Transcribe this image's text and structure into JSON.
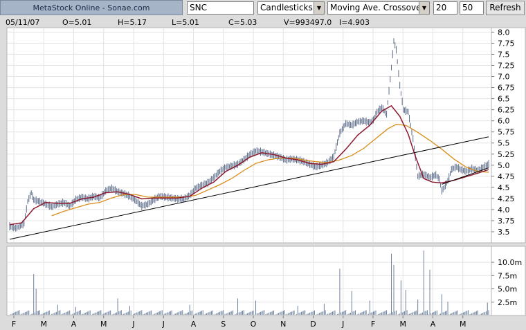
{
  "toolbar": {
    "brand": "MetaStock Online - Sonae.com",
    "symbol": "SNC",
    "chart_style": "Candlesticks",
    "indicator": "Moving Ave. Crossover",
    "period1": "20",
    "period2": "50",
    "refresh_label": "Refresh"
  },
  "info": {
    "date": "05/11/07",
    "open": "O=5.01",
    "high": "H=5.17",
    "low": "L=5.01",
    "close": "C=5.03",
    "volume": "V=993497.0",
    "indicator": "I=4.903"
  },
  "colors": {
    "price": "#5a6a88",
    "ma20": "#8b1a2e",
    "ma50": "#d98c16",
    "trend": "#000000",
    "volume": "#6b7f9c",
    "grid": "#e3e3e3"
  },
  "chart_data": [
    {
      "type": "line",
      "title": "",
      "x_tick_labels": [
        "F",
        "M",
        "A",
        "M",
        "J",
        "J",
        "A",
        "S",
        "O",
        "N",
        "D",
        "J",
        "F",
        "M",
        "A",
        "M"
      ],
      "y_ticks": [
        "3.5",
        "3.75",
        "4.0",
        "4.25",
        "4.5",
        "4.75",
        "5.0",
        "5.25",
        "5.5",
        "5.75",
        "6.0",
        "6.25",
        "6.5",
        "6.75",
        "7.0",
        "7.25",
        "7.5",
        "7.75",
        "8.0"
      ],
      "ylim": [
        3.25,
        8.1
      ],
      "grid": true,
      "series": [
        {
          "role": "price",
          "style": "candlesticks",
          "points": [
            [
              0,
              3.62
            ],
            [
              5,
              3.58
            ],
            [
              8,
              3.62
            ],
            [
              12,
              3.68
            ],
            [
              15,
              4.18
            ],
            [
              18,
              4.38
            ],
            [
              20,
              4.22
            ],
            [
              25,
              4.18
            ],
            [
              30,
              4.12
            ],
            [
              35,
              4.06
            ],
            [
              40,
              4.12
            ],
            [
              45,
              4.16
            ],
            [
              50,
              4.08
            ],
            [
              55,
              4.22
            ],
            [
              60,
              4.28
            ],
            [
              65,
              4.24
            ],
            [
              70,
              4.3
            ],
            [
              75,
              4.26
            ],
            [
              80,
              4.42
            ],
            [
              85,
              4.48
            ],
            [
              90,
              4.4
            ],
            [
              95,
              4.36
            ],
            [
              100,
              4.3
            ],
            [
              105,
              4.2
            ],
            [
              110,
              4.08
            ],
            [
              115,
              4.12
            ],
            [
              120,
              4.22
            ],
            [
              125,
              4.3
            ],
            [
              130,
              4.28
            ],
            [
              135,
              4.26
            ],
            [
              140,
              4.24
            ],
            [
              145,
              4.24
            ],
            [
              150,
              4.32
            ],
            [
              155,
              4.48
            ],
            [
              160,
              4.55
            ],
            [
              165,
              4.6
            ],
            [
              170,
              4.72
            ],
            [
              175,
              4.86
            ],
            [
              180,
              4.95
            ],
            [
              185,
              4.98
            ],
            [
              190,
              5.02
            ],
            [
              195,
              5.12
            ],
            [
              200,
              5.24
            ],
            [
              205,
              5.32
            ],
            [
              210,
              5.3
            ],
            [
              215,
              5.26
            ],
            [
              220,
              5.22
            ],
            [
              225,
              5.18
            ],
            [
              230,
              5.12
            ],
            [
              235,
              5.14
            ],
            [
              240,
              5.12
            ],
            [
              245,
              5.08
            ],
            [
              250,
              5.02
            ],
            [
              255,
              4.96
            ],
            [
              260,
              5.0
            ],
            [
              265,
              5.06
            ],
            [
              270,
              5.2
            ],
            [
              275,
              5.72
            ],
            [
              280,
              5.94
            ],
            [
              285,
              5.9
            ],
            [
              290,
              5.98
            ],
            [
              295,
              6.0
            ],
            [
              300,
              5.96
            ],
            [
              303,
              6.02
            ],
            [
              306,
              6.2
            ],
            [
              310,
              6.3
            ],
            [
              314,
              6.15
            ],
            [
              318,
              7.2
            ],
            [
              320,
              7.8
            ],
            [
              322,
              7.6
            ],
            [
              325,
              6.8
            ],
            [
              328,
              6.25
            ],
            [
              332,
              6.2
            ],
            [
              336,
              5.6
            ],
            [
              340,
              4.75
            ],
            [
              345,
              4.8
            ],
            [
              350,
              4.72
            ],
            [
              355,
              4.78
            ],
            [
              358,
              4.68
            ],
            [
              360,
              4.42
            ],
            [
              362,
              4.5
            ],
            [
              365,
              4.65
            ],
            [
              368,
              4.9
            ],
            [
              372,
              4.96
            ],
            [
              376,
              4.9
            ],
            [
              380,
              4.86
            ],
            [
              385,
              4.92
            ],
            [
              390,
              4.88
            ],
            [
              395,
              4.96
            ],
            [
              399,
              5.03
            ]
          ]
        },
        {
          "role": "indicator",
          "points": [
            [
              0,
              3.66
            ],
            [
              10,
              3.7
            ],
            [
              20,
              4.02
            ],
            [
              30,
              4.16
            ],
            [
              40,
              4.14
            ],
            [
              50,
              4.14
            ],
            [
              60,
              4.24
            ],
            [
              70,
              4.28
            ],
            [
              80,
              4.38
            ],
            [
              90,
              4.4
            ],
            [
              100,
              4.34
            ],
            [
              110,
              4.24
            ],
            [
              120,
              4.26
            ],
            [
              130,
              4.26
            ],
            [
              140,
              4.26
            ],
            [
              150,
              4.3
            ],
            [
              160,
              4.48
            ],
            [
              170,
              4.62
            ],
            [
              180,
              4.86
            ],
            [
              190,
              5.0
            ],
            [
              200,
              5.18
            ],
            [
              210,
              5.28
            ],
            [
              220,
              5.24
            ],
            [
              230,
              5.16
            ],
            [
              240,
              5.12
            ],
            [
              250,
              5.04
            ],
            [
              260,
              5.02
            ],
            [
              270,
              5.08
            ],
            [
              280,
              5.36
            ],
            [
              290,
              5.68
            ],
            [
              300,
              5.9
            ],
            [
              310,
              6.22
            ],
            [
              318,
              6.34
            ],
            [
              325,
              6.1
            ],
            [
              332,
              5.7
            ],
            [
              338,
              5.2
            ],
            [
              345,
              4.7
            ],
            [
              352,
              4.62
            ],
            [
              360,
              4.6
            ],
            [
              370,
              4.66
            ],
            [
              380,
              4.74
            ],
            [
              390,
              4.82
            ],
            [
              399,
              4.9
            ]
          ]
        },
        {
          "role": "indicator",
          "points": [
            [
              35,
              3.86
            ],
            [
              45,
              3.96
            ],
            [
              55,
              4.04
            ],
            [
              65,
              4.12
            ],
            [
              75,
              4.16
            ],
            [
              85,
              4.26
            ],
            [
              95,
              4.34
            ],
            [
              105,
              4.34
            ],
            [
              115,
              4.28
            ],
            [
              125,
              4.28
            ],
            [
              135,
              4.28
            ],
            [
              145,
              4.28
            ],
            [
              155,
              4.32
            ],
            [
              165,
              4.44
            ],
            [
              175,
              4.56
            ],
            [
              185,
              4.7
            ],
            [
              195,
              4.88
            ],
            [
              205,
              5.04
            ],
            [
              215,
              5.12
            ],
            [
              225,
              5.16
            ],
            [
              235,
              5.16
            ],
            [
              245,
              5.12
            ],
            [
              255,
              5.08
            ],
            [
              265,
              5.06
            ],
            [
              275,
              5.12
            ],
            [
              285,
              5.22
            ],
            [
              295,
              5.38
            ],
            [
              305,
              5.6
            ],
            [
              315,
              5.82
            ],
            [
              322,
              5.92
            ],
            [
              330,
              5.9
            ],
            [
              340,
              5.74
            ],
            [
              350,
              5.56
            ],
            [
              360,
              5.36
            ],
            [
              370,
              5.14
            ],
            [
              380,
              4.96
            ],
            [
              390,
              4.86
            ],
            [
              399,
              4.84
            ]
          ]
        },
        {
          "role": "trendline",
          "points": [
            [
              0,
              3.33
            ],
            [
              399,
              5.64
            ]
          ]
        },
        {
          "role": "trendline",
          "points": [
            [
              360,
              4.57
            ],
            [
              399,
              4.94
            ]
          ]
        }
      ]
    },
    {
      "type": "bar",
      "title": "",
      "y_ticks": [
        "2.5m",
        "5.0m",
        "7.5m",
        "10.0m"
      ],
      "ylim": [
        0,
        13
      ],
      "spikes": [
        [
          20,
          7.8
        ],
        [
          22,
          5.0
        ],
        [
          40,
          2.0
        ],
        [
          55,
          1.6
        ],
        [
          90,
          3.2
        ],
        [
          100,
          1.8
        ],
        [
          150,
          2.0
        ],
        [
          190,
          3.2
        ],
        [
          205,
          2.8
        ],
        [
          240,
          1.8
        ],
        [
          262,
          2.2
        ],
        [
          275,
          8.8
        ],
        [
          285,
          4.6
        ],
        [
          300,
          2.8
        ],
        [
          318,
          11.6
        ],
        [
          320,
          9.5
        ],
        [
          326,
          6.6
        ],
        [
          330,
          4.8
        ],
        [
          340,
          3.0
        ],
        [
          345,
          12.2
        ],
        [
          350,
          8.6
        ],
        [
          360,
          4.0
        ],
        [
          365,
          2.6
        ],
        [
          398,
          2.4
        ]
      ]
    }
  ]
}
